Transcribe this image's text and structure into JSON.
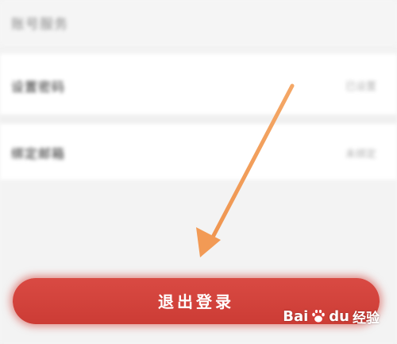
{
  "settings": {
    "section_header": "账号服务",
    "rows": [
      {
        "label": "设置密码",
        "value": "已设置"
      },
      {
        "label": "绑定邮箱",
        "value": "未绑定"
      }
    ]
  },
  "logout": {
    "label": "退出登录"
  },
  "watermark": {
    "text_bai": "Bai",
    "text_du": "du",
    "text_jingyan": "经验"
  },
  "colors": {
    "logout_red": "#d2433c",
    "arrow_orange": "#f2a15e",
    "background": "#f3f3f3"
  }
}
